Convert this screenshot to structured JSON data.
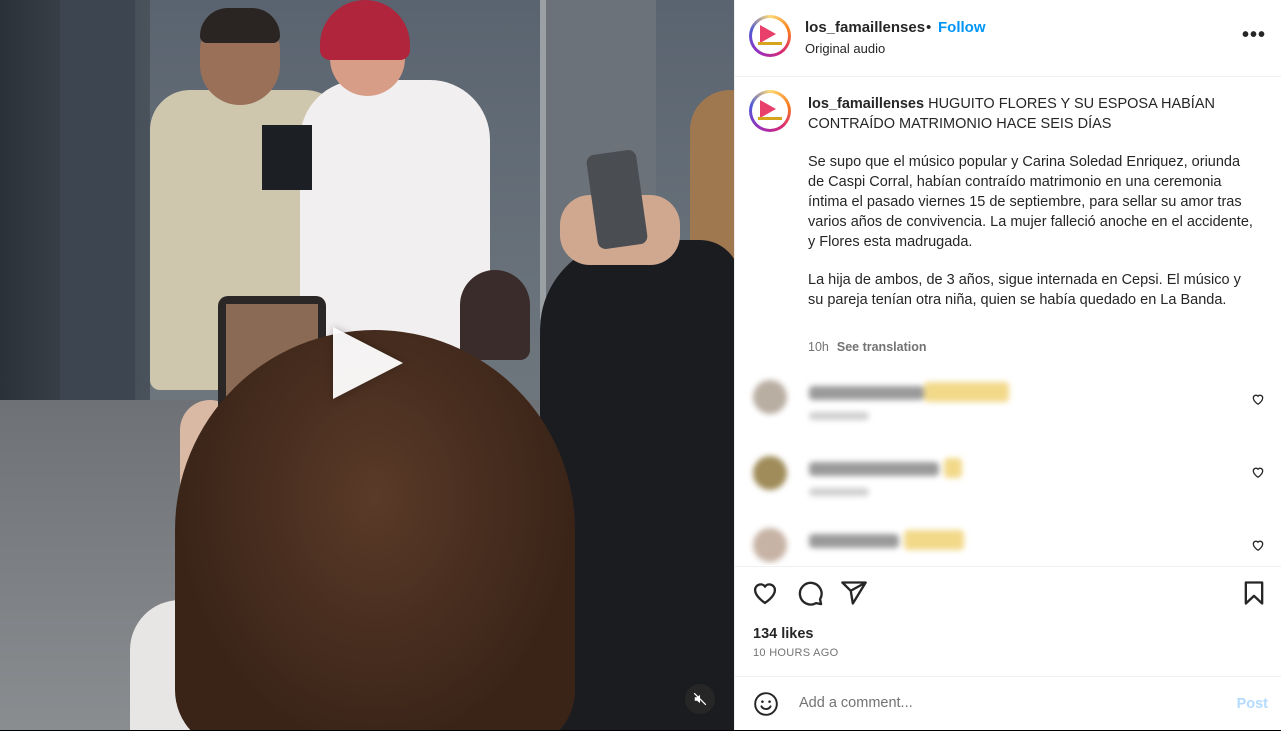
{
  "post": {
    "username": "los_famaillenses",
    "separator": "•",
    "follow_label": "Follow",
    "audio": "Original audio",
    "more": "•••"
  },
  "caption": {
    "username": "los_famaillenses",
    "headline": "HUGUITO FLORES Y SU ESPOSA HABÍAN CONTRAÍDO MATRIMONIO HACE SEIS DÍAS",
    "paragraph1": "Se supo que el músico popular y Carina Soledad Enriquez, oriunda de Caspi Corral, habían contraído matrimonio en una ceremonia íntima el pasado viernes 15 de septiembre, para sellar su amor tras varios años de convivencia. La mujer falleció anoche en el accidente, y Flores esta madrugada.",
    "paragraph2": "La hija de ambos, de 3 años, sigue internada en Cepsi. El músico y su pareja tenían otra niña, quien se había quedado en La Banda.",
    "time": "10h",
    "see_translation": "See translation"
  },
  "engagement": {
    "likes": "134 likes",
    "posted": "10 HOURS AGO"
  },
  "comment_box": {
    "placeholder": "Add a comment...",
    "post_label": "Post"
  },
  "colors": {
    "link_blue": "#0095f6",
    "post_disabled": "#b3dbff",
    "muted_text": "#737373"
  },
  "icons": [
    "play-icon",
    "muted-speaker-icon",
    "more-icon",
    "heart-icon",
    "comment-icon",
    "share-icon",
    "bookmark-icon",
    "emoji-icon"
  ]
}
